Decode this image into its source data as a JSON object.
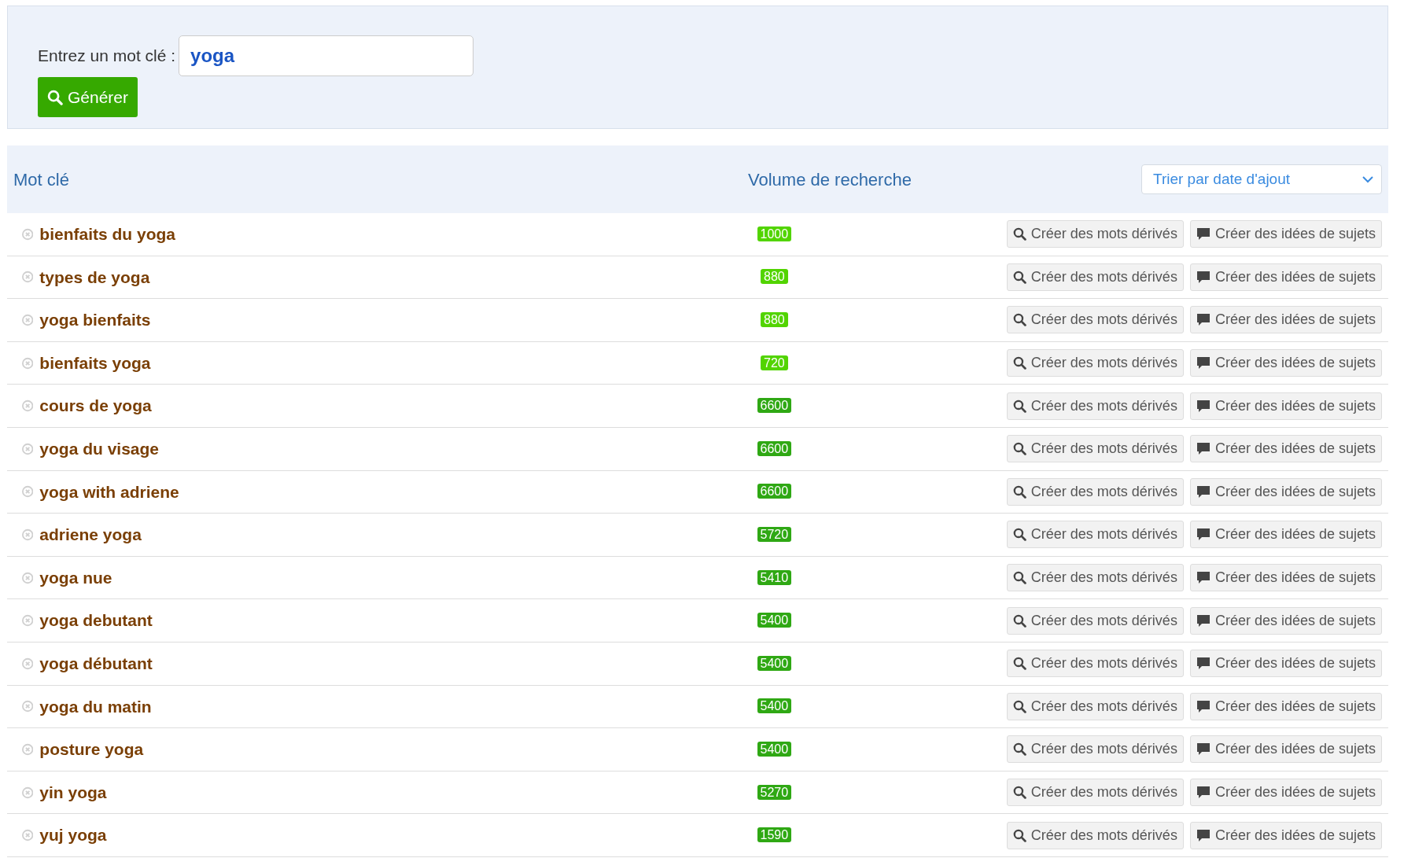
{
  "search_form": {
    "label": "Entrez un mot clé :",
    "value": "yoga",
    "button": "Générer"
  },
  "table": {
    "columns": [
      "Mot clé",
      "Volume de recherche"
    ],
    "sort_select": "Trier par date d'ajout",
    "rows": [
      {
        "keyword": "bienfaits du yoga",
        "volume": "1000",
        "color": "#52d400",
        "actions": [
          "Créer des mots dérivés",
          "Créer des idées de sujets"
        ]
      },
      {
        "keyword": "types de yoga",
        "volume": "880",
        "color": "#52d400",
        "actions": [
          "Créer des mots dérivés",
          "Créer des idées de sujets"
        ]
      },
      {
        "keyword": "yoga bienfaits",
        "volume": "880",
        "color": "#52d400",
        "actions": [
          "Créer des mots dérivés",
          "Créer des idées de sujets"
        ]
      },
      {
        "keyword": "bienfaits yoga",
        "volume": "720",
        "color": "#52d400",
        "actions": [
          "Créer des mots dérivés",
          "Créer des idées de sujets"
        ]
      },
      {
        "keyword": "cours de yoga",
        "volume": "6600",
        "color": "#2fa814",
        "actions": [
          "Créer des mots dérivés",
          "Créer des idées de sujets"
        ]
      },
      {
        "keyword": "yoga du visage",
        "volume": "6600",
        "color": "#2fa814",
        "actions": [
          "Créer des mots dérivés",
          "Créer des idées de sujets"
        ]
      },
      {
        "keyword": "yoga with adriene",
        "volume": "6600",
        "color": "#2fa814",
        "actions": [
          "Créer des mots dérivés",
          "Créer des idées de sujets"
        ]
      },
      {
        "keyword": "adriene yoga",
        "volume": "5720",
        "color": "#2fa814",
        "actions": [
          "Créer des mots dérivés",
          "Créer des idées de sujets"
        ]
      },
      {
        "keyword": "yoga nue",
        "volume": "5410",
        "color": "#2fa814",
        "actions": [
          "Créer des mots dérivés",
          "Créer des idées de sujets"
        ]
      },
      {
        "keyword": "yoga debutant",
        "volume": "5400",
        "color": "#2fa814",
        "actions": [
          "Créer des mots dérivés",
          "Créer des idées de sujets"
        ]
      },
      {
        "keyword": "yoga débutant",
        "volume": "5400",
        "color": "#2fa814",
        "actions": [
          "Créer des mots dérivés",
          "Créer des idées de sujets"
        ]
      },
      {
        "keyword": "yoga du matin",
        "volume": "5400",
        "color": "#2fa814",
        "actions": [
          "Créer des mots dérivés",
          "Créer des idées de sujets"
        ]
      },
      {
        "keyword": "posture yoga",
        "volume": "5400",
        "color": "#2fa814",
        "actions": [
          "Créer des mots dérivés",
          "Créer des idées de sujets"
        ]
      },
      {
        "keyword": "yin yoga",
        "volume": "5270",
        "color": "#2fa814",
        "actions": [
          "Créer des mots dérivés",
          "Créer des idées de sujets"
        ]
      },
      {
        "keyword": "yuj yoga",
        "volume": "1590",
        "color": "#2fa814",
        "actions": [
          "Créer des mots dérivés",
          "Créer des idées de sujets"
        ]
      }
    ]
  }
}
